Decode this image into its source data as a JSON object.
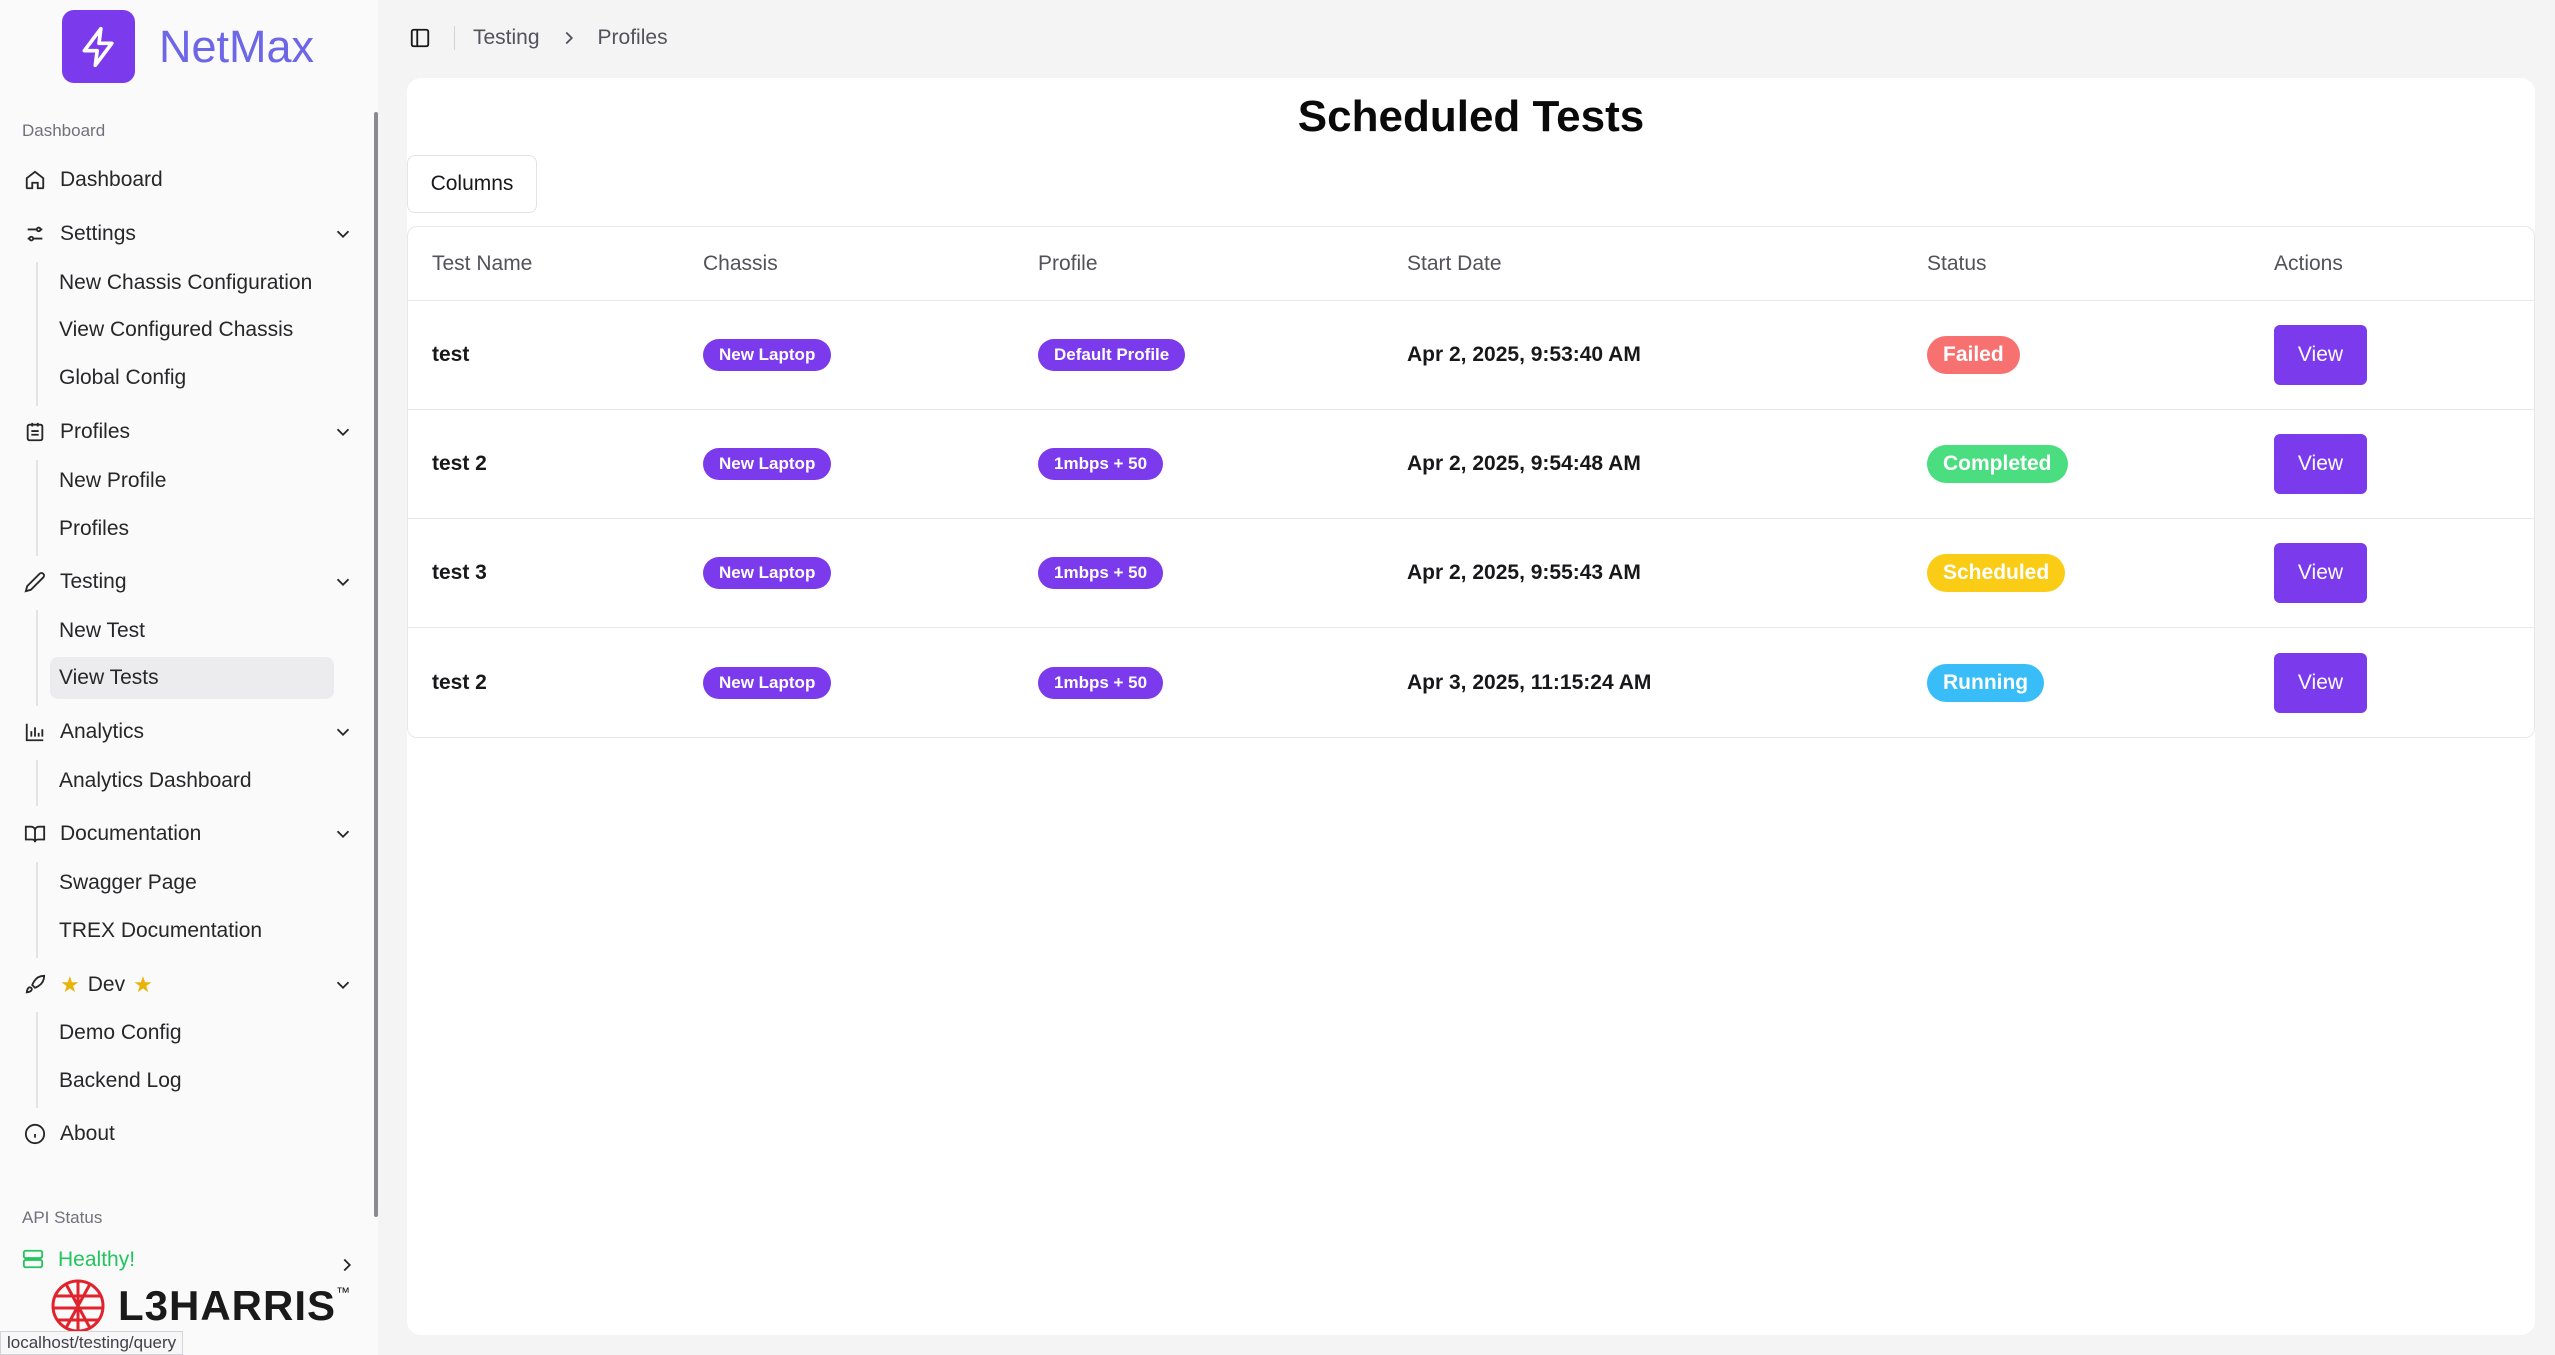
{
  "brand": {
    "name": "NetMax",
    "accent": "#7c3aed"
  },
  "sidebar": {
    "group_dashboard": "Dashboard",
    "dashboard": "Dashboard",
    "settings": {
      "label": "Settings",
      "items": [
        "New Chassis Configuration",
        "View Configured Chassis",
        "Global Config"
      ]
    },
    "profiles": {
      "label": "Profiles",
      "items": [
        "New Profile",
        "Profiles"
      ]
    },
    "testing": {
      "label": "Testing",
      "items": [
        "New Test",
        "View Tests"
      ],
      "active_item": "View Tests"
    },
    "analytics": {
      "label": "Analytics",
      "items": [
        "Analytics Dashboard"
      ]
    },
    "documentation": {
      "label": "Documentation",
      "items": [
        "Swagger Page",
        "TREX Documentation"
      ]
    },
    "dev": {
      "label": "Dev",
      "items": [
        "Demo Config",
        "Backend Log"
      ]
    },
    "about": "About",
    "group_api": "API Status",
    "api_status": "Healthy!",
    "company": "L3HARRIS",
    "company_tm": "™"
  },
  "breadcrumb": [
    "Testing",
    "Profiles"
  ],
  "page_title": "Scheduled Tests",
  "columns_button": "Columns",
  "table": {
    "headers": [
      "Test Name",
      "Chassis",
      "Profile",
      "Start Date",
      "Status",
      "Actions"
    ],
    "rows": [
      {
        "name": "test",
        "chassis": "New Laptop",
        "profile": "Default Profile",
        "start": "Apr 2, 2025, 9:53:40 AM",
        "status": "Failed",
        "status_color": "#f87171",
        "action": "View"
      },
      {
        "name": "test 2",
        "chassis": "New Laptop",
        "profile": "1mbps + 50",
        "start": "Apr 2, 2025, 9:54:48 AM",
        "status": "Completed",
        "status_color": "#4ade80",
        "action": "View"
      },
      {
        "name": "test 3",
        "chassis": "New Laptop",
        "profile": "1mbps + 50",
        "start": "Apr 2, 2025, 9:55:43 AM",
        "status": "Scheduled",
        "status_color": "#facc15",
        "action": "View"
      },
      {
        "name": "test 2",
        "chassis": "New Laptop",
        "profile": "1mbps + 50",
        "start": "Apr 3, 2025, 11:15:24 AM",
        "status": "Running",
        "status_color": "#38bdf8",
        "action": "View"
      }
    ]
  },
  "status_url": "localhost/testing/query"
}
